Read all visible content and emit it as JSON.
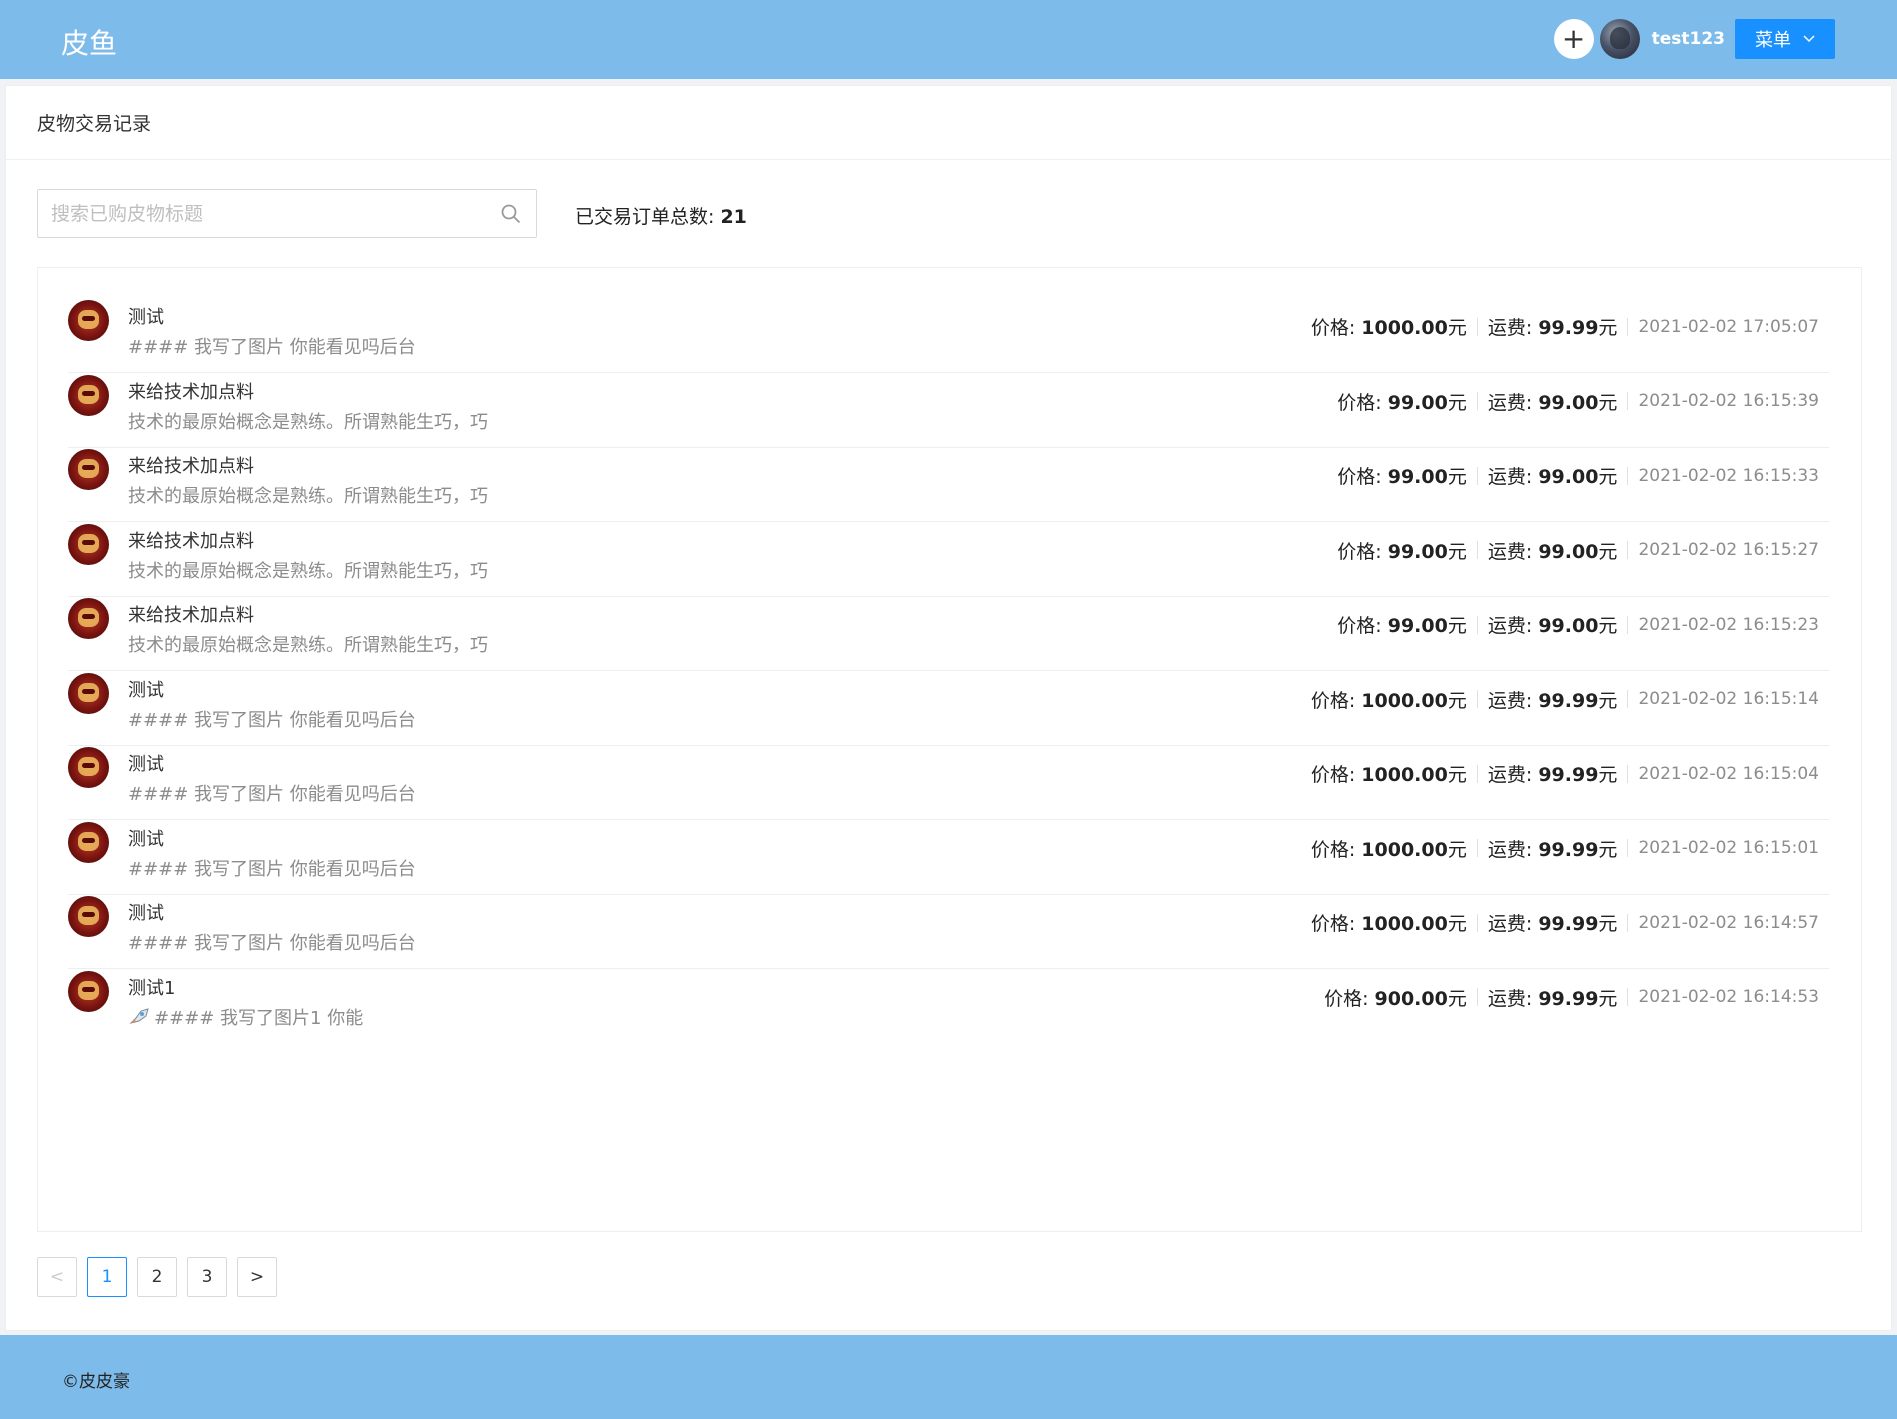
{
  "header": {
    "logo": "皮鱼",
    "plus_symbol": "+",
    "username": "test123",
    "menu_label": "菜单"
  },
  "panel": {
    "title": "皮物交易记录"
  },
  "search": {
    "placeholder": "搜索已购皮物标题",
    "value": ""
  },
  "summary": {
    "label": "已交易订单总数: ",
    "count": "21"
  },
  "orders": [
    {
      "title": "测试",
      "desc": "#### 我写了图片 你能看见吗后台",
      "price": "1000.00",
      "shipping": "99.99",
      "time": "2021-02-02 17:05:07",
      "rocket": false
    },
    {
      "title": "来给技术加点料",
      "desc": "技术的最原始概念是熟练。所谓熟能生巧，巧",
      "price": "99.00",
      "shipping": "99.00",
      "time": "2021-02-02 16:15:39",
      "rocket": false
    },
    {
      "title": "来给技术加点料",
      "desc": "技术的最原始概念是熟练。所谓熟能生巧，巧",
      "price": "99.00",
      "shipping": "99.00",
      "time": "2021-02-02 16:15:33",
      "rocket": false
    },
    {
      "title": "来给技术加点料",
      "desc": "技术的最原始概念是熟练。所谓熟能生巧，巧",
      "price": "99.00",
      "shipping": "99.00",
      "time": "2021-02-02 16:15:27",
      "rocket": false
    },
    {
      "title": "来给技术加点料",
      "desc": "技术的最原始概念是熟练。所谓熟能生巧，巧",
      "price": "99.00",
      "shipping": "99.00",
      "time": "2021-02-02 16:15:23",
      "rocket": false
    },
    {
      "title": "测试",
      "desc": "#### 我写了图片 你能看见吗后台",
      "price": "1000.00",
      "shipping": "99.99",
      "time": "2021-02-02 16:15:14",
      "rocket": false
    },
    {
      "title": "测试",
      "desc": "#### 我写了图片 你能看见吗后台",
      "price": "1000.00",
      "shipping": "99.99",
      "time": "2021-02-02 16:15:04",
      "rocket": false
    },
    {
      "title": "测试",
      "desc": "#### 我写了图片 你能看见吗后台",
      "price": "1000.00",
      "shipping": "99.99",
      "time": "2021-02-02 16:15:01",
      "rocket": false
    },
    {
      "title": "测试",
      "desc": "#### 我写了图片 你能看见吗后台",
      "price": "1000.00",
      "shipping": "99.99",
      "time": "2021-02-02 16:14:57",
      "rocket": false
    },
    {
      "title": "测试1",
      "desc": "#### 我写了图片1 你能",
      "price": "900.00",
      "shipping": "99.99",
      "time": "2021-02-02 16:14:53",
      "rocket": true
    }
  ],
  "labels": {
    "price": "价格: ",
    "shipping": "运费: ",
    "unit": "元"
  },
  "pagination": {
    "prev": "<",
    "next": ">",
    "pages": [
      "1",
      "2",
      "3"
    ],
    "current": "1"
  },
  "footer": {
    "text": "©皮皮豪"
  },
  "colors": {
    "header_bg": "#7dbbea",
    "primary": "#1890ff"
  }
}
